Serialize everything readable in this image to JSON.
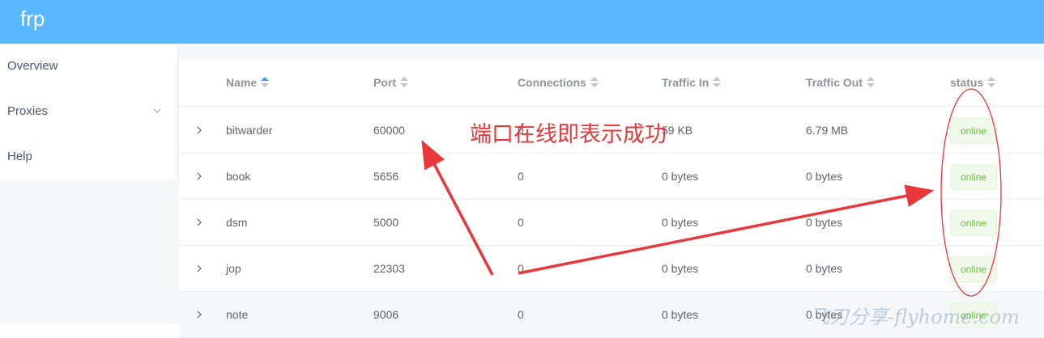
{
  "app": {
    "logo": "frp"
  },
  "sidebar": {
    "items": [
      {
        "label": "Overview"
      },
      {
        "label": "Proxies"
      },
      {
        "label": "Help"
      }
    ]
  },
  "table": {
    "columns": [
      "Name",
      "Port",
      "Connections",
      "Traffic In",
      "Traffic Out",
      "status"
    ],
    "rows": [
      {
        "name": "bitwarder",
        "port": "60000",
        "connections": "0",
        "traffic_in": "59 KB",
        "traffic_out": "6.79 MB",
        "status": "online"
      },
      {
        "name": "book",
        "port": "5656",
        "connections": "0",
        "traffic_in": "0 bytes",
        "traffic_out": "0 bytes",
        "status": "online"
      },
      {
        "name": "dsm",
        "port": "5000",
        "connections": "0",
        "traffic_in": "0 bytes",
        "traffic_out": "0 bytes",
        "status": "online"
      },
      {
        "name": "jop",
        "port": "22303",
        "connections": "0",
        "traffic_in": "0 bytes",
        "traffic_out": "0 bytes",
        "status": "online"
      },
      {
        "name": "note",
        "port": "9006",
        "connections": "0",
        "traffic_in": "0 bytes",
        "traffic_out": "0 bytes",
        "status": "online"
      }
    ]
  },
  "annotation": {
    "text": "端口在线即表示成功",
    "color": "#e8383b"
  },
  "watermark": {
    "text": "飞刃分享-flyhome.com"
  },
  "colors": {
    "header": "#58b7ff",
    "online": "#67c23a",
    "sort_active": "#409eff"
  }
}
